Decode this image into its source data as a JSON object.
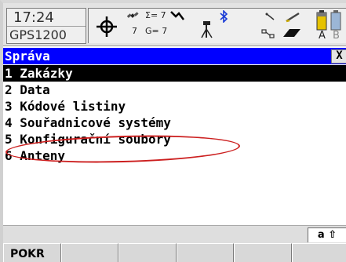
{
  "status": {
    "time": "17:24",
    "instrument": "GPS1200",
    "satellites_sigma": "Σ= 7",
    "satellites_g": "G= 7",
    "satellites_small": "7",
    "bluetooth_icon": "bluetooth-icon",
    "storage_label": "A",
    "storage_label_b": "B"
  },
  "window": {
    "title": "Správa",
    "close_label": "X"
  },
  "menu": {
    "items": [
      {
        "label": "1 Zakázky",
        "selected": true
      },
      {
        "label": "2 Data",
        "selected": false
      },
      {
        "label": "3 Kódové listiny",
        "selected": false
      },
      {
        "label": "4 Souřadnicové systémy",
        "selected": false
      },
      {
        "label": "5 Konfigurační soubory",
        "selected": false
      },
      {
        "label": "6 Anteny",
        "selected": false
      }
    ]
  },
  "input_mode": "a ⇧",
  "fkeys": [
    {
      "label": "POKR"
    },
    {
      "label": ""
    },
    {
      "label": ""
    },
    {
      "label": ""
    },
    {
      "label": ""
    },
    {
      "label": ""
    }
  ],
  "colors": {
    "title_bg": "#0000ff",
    "selected_bg": "#000000",
    "annotation": "#cc1f1f"
  }
}
